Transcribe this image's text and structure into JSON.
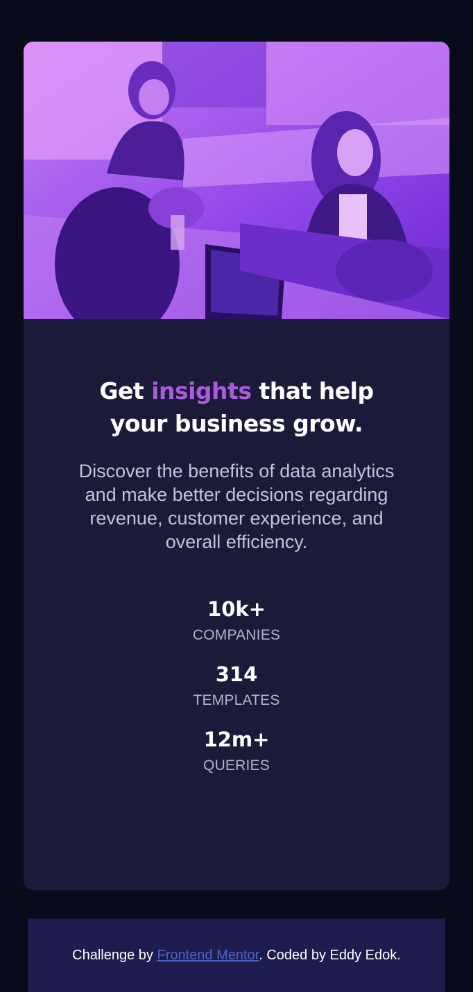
{
  "card": {
    "hero": {
      "image": "photo-of-team-working-in-office",
      "overlay_color": "#8a40e6"
    },
    "headline": {
      "before": "Get",
      "accent": "insights",
      "after": "that help your business grow."
    },
    "description": "Discover the benefits of data analytics and make better decisions regarding revenue, customer experience, and overall efficiency.",
    "stats": [
      {
        "value": "10k+",
        "label": "COMPANIES"
      },
      {
        "value": "314",
        "label": "TEMPLATES"
      },
      {
        "value": "12m+",
        "label": "QUERIES"
      }
    ]
  },
  "footer": {
    "prefix": "Challenge by",
    "link_text": "Frontend Mentor",
    "suffix": ". Coded by Eddy Edok."
  },
  "colors": {
    "page_background": "#090b1a",
    "card_background": "#1c1a39",
    "accent": "#aa5cdb",
    "footer_background": "#1e1b4f",
    "link": "#4b64c4"
  }
}
